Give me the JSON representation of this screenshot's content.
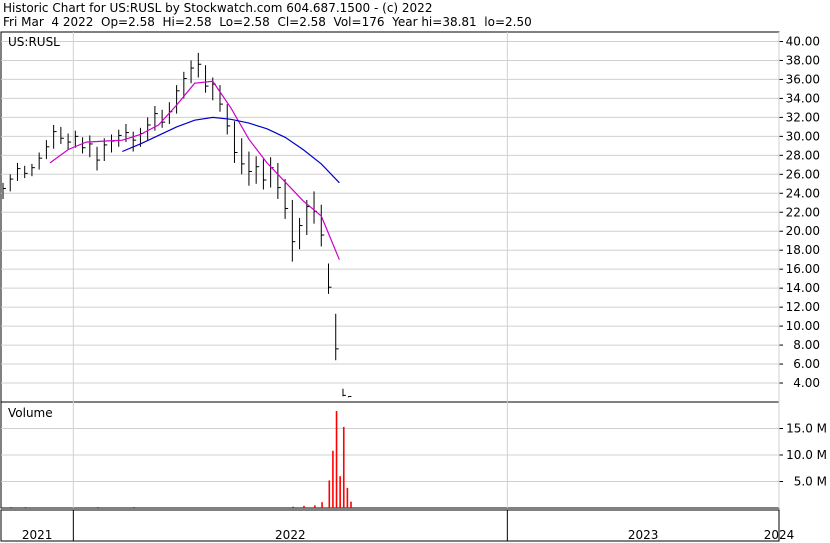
{
  "header": {
    "line1": "Historic Chart for US:RUSL by Stockwatch.com 604.687.1500 - (c) 2022",
    "line2": "Fri Mar  4 2022  Op=2.58  Hi=2.58  Lo=2.58  Cl=2.58  Vol=176  Year hi=38.81  lo=2.50"
  },
  "chart_data": [
    {
      "type": "line",
      "title": "US:RUSL",
      "ylim": [
        2,
        41
      ],
      "y_ticks": [
        "4.00",
        "6.00",
        "8.00",
        "10.00",
        "12.00",
        "14.00",
        "16.00",
        "18.00",
        "20.00",
        "22.00",
        "24.00",
        "26.00",
        "28.00",
        "30.00",
        "32.00",
        "34.00",
        "36.00",
        "38.00",
        "40.00"
      ],
      "x_ticks": [
        "2021",
        "2022",
        "2023",
        "2024"
      ],
      "grid": true,
      "colors": {
        "price": "#000000",
        "ma_short": "#cc00cc",
        "ma_long": "#0000cc",
        "grid": "#d0d0d0"
      },
      "price_bars": [
        {
          "x": 0.0,
          "h": 25.1,
          "l": 23.4,
          "c": 24.5
        },
        {
          "x": 0.2,
          "h": 26.0,
          "l": 24.2,
          "c": 25.5
        },
        {
          "x": 0.4,
          "h": 27.2,
          "l": 25.3,
          "c": 26.6
        },
        {
          "x": 0.6,
          "h": 26.9,
          "l": 25.6,
          "c": 26.1
        },
        {
          "x": 0.8,
          "h": 27.1,
          "l": 25.8,
          "c": 26.7
        },
        {
          "x": 1.0,
          "h": 28.3,
          "l": 26.5,
          "c": 27.7
        },
        {
          "x": 1.2,
          "h": 29.6,
          "l": 27.6,
          "c": 28.9
        },
        {
          "x": 1.4,
          "h": 31.2,
          "l": 28.7,
          "c": 30.5
        },
        {
          "x": 1.6,
          "h": 31.0,
          "l": 29.2,
          "c": 29.8
        },
        {
          "x": 1.8,
          "h": 30.3,
          "l": 28.6,
          "c": 29.4
        },
        {
          "x": 2.0,
          "h": 30.6,
          "l": 28.8,
          "c": 30.0
        },
        {
          "x": 2.2,
          "h": 29.9,
          "l": 28.2,
          "c": 28.8
        },
        {
          "x": 2.4,
          "h": 30.1,
          "l": 27.8,
          "c": 29.2
        },
        {
          "x": 2.6,
          "h": 28.9,
          "l": 26.4,
          "c": 27.5
        },
        {
          "x": 2.8,
          "h": 29.8,
          "l": 27.4,
          "c": 29.1
        },
        {
          "x": 3.0,
          "h": 30.2,
          "l": 28.3,
          "c": 29.5
        },
        {
          "x": 3.2,
          "h": 30.7,
          "l": 28.9,
          "c": 30.1
        },
        {
          "x": 3.4,
          "h": 31.3,
          "l": 29.4,
          "c": 30.4
        },
        {
          "x": 3.6,
          "h": 30.5,
          "l": 28.4,
          "c": 29.6
        },
        {
          "x": 3.8,
          "h": 30.9,
          "l": 28.9,
          "c": 30.3
        },
        {
          "x": 4.0,
          "h": 32.0,
          "l": 29.6,
          "c": 31.2
        },
        {
          "x": 4.2,
          "h": 33.2,
          "l": 30.6,
          "c": 32.4
        },
        {
          "x": 4.4,
          "h": 32.8,
          "l": 30.9,
          "c": 31.5
        },
        {
          "x": 4.6,
          "h": 33.6,
          "l": 31.3,
          "c": 32.6
        },
        {
          "x": 4.8,
          "h": 35.4,
          "l": 32.4,
          "c": 34.8
        },
        {
          "x": 5.0,
          "h": 36.8,
          "l": 34.0,
          "c": 36.1
        },
        {
          "x": 5.2,
          "h": 38.0,
          "l": 35.6,
          "c": 37.2
        },
        {
          "x": 5.4,
          "h": 38.8,
          "l": 36.2,
          "c": 37.6
        },
        {
          "x": 5.6,
          "h": 37.5,
          "l": 34.6,
          "c": 35.3
        },
        {
          "x": 5.8,
          "h": 36.2,
          "l": 33.8,
          "c": 35.5
        },
        {
          "x": 6.0,
          "h": 35.4,
          "l": 32.6,
          "c": 33.4
        },
        {
          "x": 6.2,
          "h": 33.4,
          "l": 30.2,
          "c": 31.1
        },
        {
          "x": 6.4,
          "h": 31.6,
          "l": 27.2,
          "c": 28.3
        },
        {
          "x": 6.6,
          "h": 29.8,
          "l": 26.0,
          "c": 27.1
        },
        {
          "x": 6.8,
          "h": 28.4,
          "l": 24.8,
          "c": 26.3
        },
        {
          "x": 7.0,
          "h": 27.9,
          "l": 25.0,
          "c": 26.8
        },
        {
          "x": 7.2,
          "h": 27.6,
          "l": 24.4,
          "c": 25.4
        },
        {
          "x": 7.4,
          "h": 27.8,
          "l": 24.6,
          "c": 26.7
        },
        {
          "x": 7.6,
          "h": 27.2,
          "l": 23.4,
          "c": 24.6
        },
        {
          "x": 7.8,
          "h": 25.5,
          "l": 21.3,
          "c": 22.4
        },
        {
          "x": 8.0,
          "h": 23.3,
          "l": 16.8,
          "c": 18.9
        },
        {
          "x": 8.2,
          "h": 21.4,
          "l": 18.1,
          "c": 20.6
        },
        {
          "x": 8.4,
          "h": 23.3,
          "l": 19.6,
          "c": 22.6
        },
        {
          "x": 8.6,
          "h": 24.2,
          "l": 20.8,
          "c": 22.1
        },
        {
          "x": 8.8,
          "h": 22.8,
          "l": 18.4,
          "c": 19.6
        },
        {
          "x": 9.0,
          "h": 16.6,
          "l": 13.4,
          "c": 14.1
        },
        {
          "x": 9.2,
          "h": 11.3,
          "l": 6.4,
          "c": 7.6
        },
        {
          "x": 9.4,
          "h": 3.4,
          "l": 2.6,
          "c": 2.7
        },
        {
          "x": 9.55,
          "h": 2.6,
          "l": 2.5,
          "c": 2.58
        }
      ],
      "ma_short": [
        [
          1.3,
          27.2
        ],
        [
          1.8,
          28.6
        ],
        [
          2.3,
          29.4
        ],
        [
          2.8,
          29.5
        ],
        [
          3.3,
          29.6
        ],
        [
          3.8,
          30.2
        ],
        [
          4.3,
          31.2
        ],
        [
          4.8,
          33.3
        ],
        [
          5.3,
          35.6
        ],
        [
          5.8,
          35.8
        ],
        [
          6.3,
          33.0
        ],
        [
          6.8,
          29.7
        ],
        [
          7.3,
          27.2
        ],
        [
          7.8,
          25.2
        ],
        [
          8.3,
          23.2
        ],
        [
          8.8,
          21.6
        ],
        [
          9.3,
          17.0
        ]
      ],
      "ma_long": [
        [
          3.3,
          28.4
        ],
        [
          3.8,
          29.2
        ],
        [
          4.3,
          30.1
        ],
        [
          4.8,
          31.0
        ],
        [
          5.3,
          31.7
        ],
        [
          5.8,
          32.0
        ],
        [
          6.3,
          31.8
        ],
        [
          6.8,
          31.4
        ],
        [
          7.3,
          30.8
        ],
        [
          7.8,
          29.9
        ],
        [
          8.3,
          28.6
        ],
        [
          8.8,
          27.1
        ],
        [
          9.3,
          25.1
        ]
      ]
    },
    {
      "type": "bar",
      "title": "Volume",
      "ylim": [
        0,
        20
      ],
      "y_ticks": [
        "5.0 M",
        "10.0 M",
        "15.0 M"
      ],
      "colors": {
        "volume": "#ff0000"
      },
      "bars": [
        {
          "x": 0.2,
          "v": 0.05
        },
        {
          "x": 0.6,
          "v": 0.04
        },
        {
          "x": 2.6,
          "v": 0.05
        },
        {
          "x": 3.6,
          "v": 0.06
        },
        {
          "x": 8.0,
          "v": 0.25
        },
        {
          "x": 8.3,
          "v": 0.4
        },
        {
          "x": 8.6,
          "v": 0.5
        },
        {
          "x": 8.8,
          "v": 1.1
        },
        {
          "x": 9.0,
          "v": 5.2
        },
        {
          "x": 9.1,
          "v": 10.8
        },
        {
          "x": 9.2,
          "v": 18.3
        },
        {
          "x": 9.3,
          "v": 6.0
        },
        {
          "x": 9.4,
          "v": 15.3
        },
        {
          "x": 9.5,
          "v": 3.8
        },
        {
          "x": 9.6,
          "v": 1.2
        }
      ]
    }
  ]
}
